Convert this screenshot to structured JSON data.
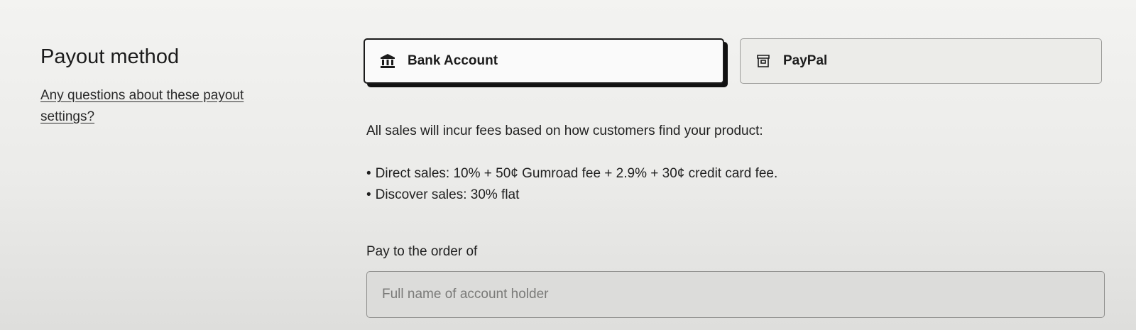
{
  "sidebar": {
    "title": "Payout method",
    "help_link": "Any questions about these payout settings?"
  },
  "payout_methods": [
    {
      "label": "Bank Account",
      "icon": "bank-icon",
      "selected": true
    },
    {
      "label": "PayPal",
      "icon": "paypal-icon",
      "selected": false
    }
  ],
  "fees": {
    "intro": "All sales will incur fees based on how customers find your product:",
    "items": [
      "Direct sales: 10% + 50¢ Gumroad fee + 2.9% + 30¢ credit card fee.",
      "Discover sales: 30% flat"
    ]
  },
  "pay_to": {
    "label": "Pay to the order of",
    "placeholder": "Full name of account holder",
    "value": ""
  }
}
